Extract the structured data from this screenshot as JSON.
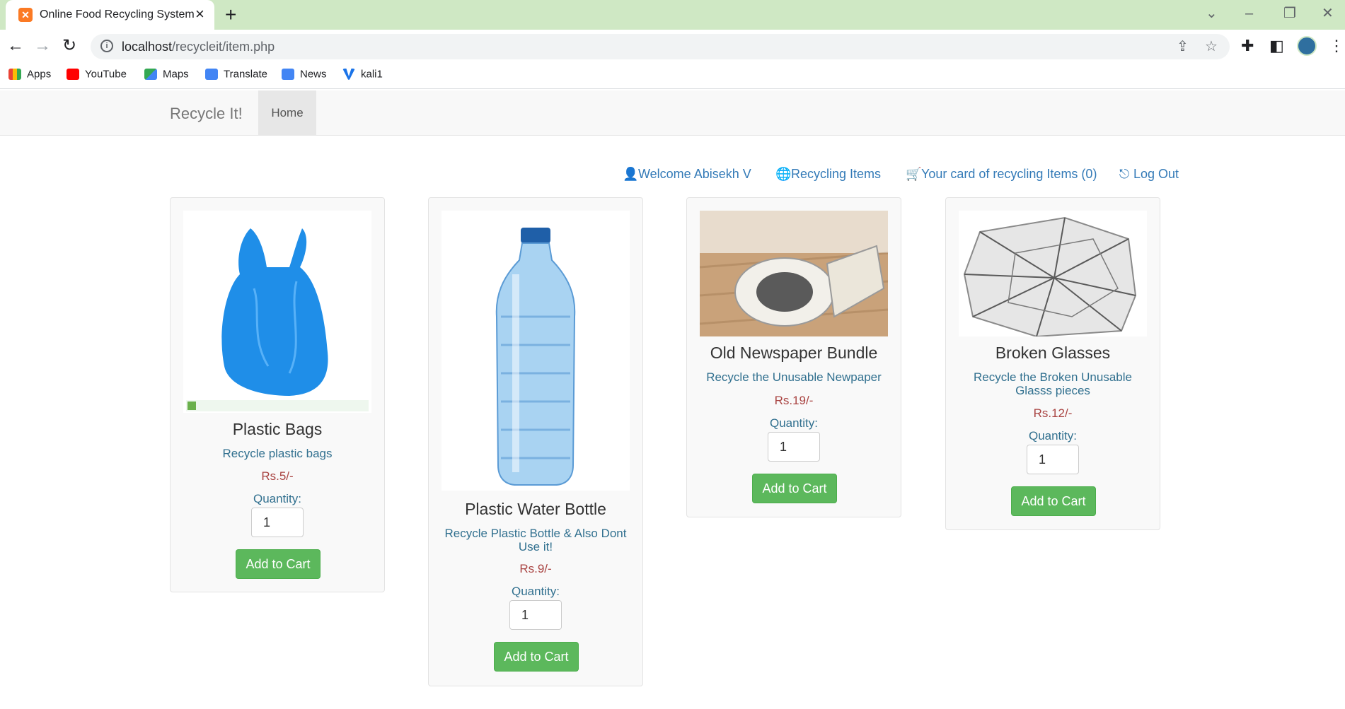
{
  "browser": {
    "tab_title": "Online Food Recycling System",
    "url_host": "localhost",
    "url_path": "/recycleit/item.php",
    "bookmarks": [
      {
        "label": "Apps"
      },
      {
        "label": "YouTube"
      },
      {
        "label": "Maps"
      },
      {
        "label": "Translate"
      },
      {
        "label": "News"
      },
      {
        "label": "kali1"
      }
    ]
  },
  "navbar": {
    "brand": "Recycle It!",
    "home": "Home"
  },
  "userlinks": {
    "welcome": "Welcome Abisekh V",
    "items": "Recycling Items",
    "cart": "Your card of recycling Items (0)",
    "logout": "Log Out"
  },
  "products": [
    {
      "name": "Plastic Bags",
      "desc": "Recycle plastic bags",
      "price": "Rs.5/-",
      "qty_label": "Quantity:",
      "qty": "1",
      "button": "Add to Cart"
    },
    {
      "name": "Plastic Water Bottle",
      "desc": "Recycle Plastic Bottle & Also Dont Use it!",
      "price": "Rs.9/-",
      "qty_label": "Quantity:",
      "qty": "1",
      "button": "Add to Cart"
    },
    {
      "name": "Old Newspaper Bundle",
      "desc": "Recycle the Unusable Newpaper",
      "price": "Rs.19/-",
      "qty_label": "Quantity:",
      "qty": "1",
      "button": "Add to Cart"
    },
    {
      "name": "Broken Glasses",
      "desc": "Recycle the Broken Unusable Glasss pieces",
      "price": "Rs.12/-",
      "qty_label": "Quantity:",
      "qty": "1",
      "button": "Add to Cart"
    }
  ],
  "colors": {
    "tabstrip": "#cfe8c4",
    "link": "#337ab7",
    "desc": "#31708f",
    "price": "#a94442",
    "button": "#5cb85c"
  }
}
